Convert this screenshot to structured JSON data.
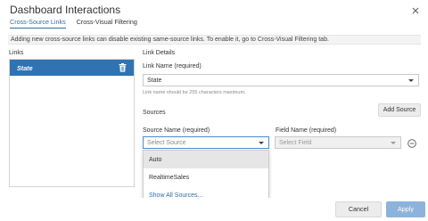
{
  "dialog": {
    "title": "Dashboard Interactions",
    "tabs": [
      {
        "label": "Cross-Source Links",
        "active": true
      },
      {
        "label": "Cross-Visual Filtering",
        "active": false
      }
    ],
    "notice": "Adding new cross-source links can disable existing same-source links. To enable it, go to Cross-Visual Filtering tab."
  },
  "links": {
    "heading": "Links",
    "items": [
      {
        "label": "State",
        "selected": true
      }
    ]
  },
  "details": {
    "heading": "Link Details",
    "link_name_label": "Link Name (required)",
    "link_name_value": "State",
    "link_name_hint": "Link name should be 255 characters maximum.",
    "sources_heading": "Sources",
    "add_source_label": "Add Source",
    "source_name_label": "Source Name (required)",
    "field_name_label": "Field Name (required)",
    "source_placeholder": "Select Source",
    "field_placeholder": "Select Field"
  },
  "source_dropdown": {
    "options": [
      "Auto",
      "RealtimeSales",
      "Show All Sources..."
    ]
  },
  "footer": {
    "cancel_label": "Cancel",
    "apply_label": "Apply"
  },
  "colors": {
    "accent": "#2f73b3",
    "apply_disabled": "#8cb3dc"
  }
}
